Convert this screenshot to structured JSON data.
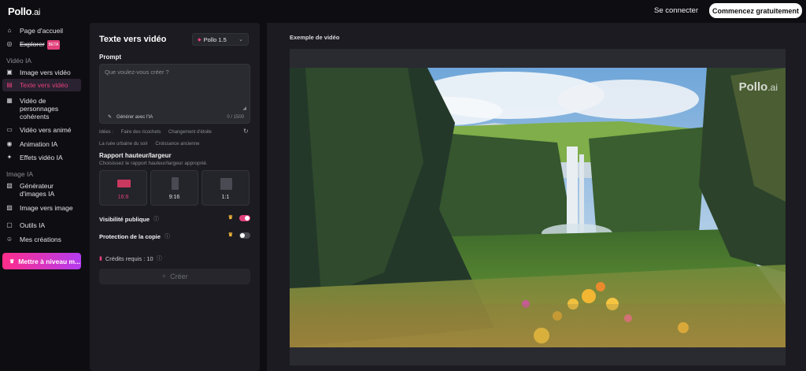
{
  "header": {
    "logo": "Pollo",
    "logo_suffix": ".ai",
    "sign_in": "Se connecter",
    "start_free": "Commencez gratuitement"
  },
  "sidebar": {
    "home": "Page d'accueil",
    "explore": "Explorer",
    "explore_badge": "BETA",
    "section_video": "Vidéo IA",
    "video_items": [
      {
        "label": "Image vers vidéo",
        "icon": "image-video-icon"
      },
      {
        "label": "Texte vers vidéo",
        "icon": "text-video-icon",
        "active": true
      },
      {
        "label": "Vidéo de personnages cohérents",
        "icon": "character-video-icon"
      },
      {
        "label": "Vidéo vers animé",
        "icon": "anime-icon"
      },
      {
        "label": "Animation IA",
        "icon": "animation-icon"
      },
      {
        "label": "Effets vidéo IA",
        "icon": "effects-icon"
      }
    ],
    "section_image": "Image IA",
    "image_items": [
      {
        "label": "Générateur d'images IA",
        "icon": "image-generator-icon"
      },
      {
        "label": "Image vers image",
        "icon": "image-to-image-icon"
      }
    ],
    "tools": "Outils IA",
    "creations": "Mes créations",
    "upgrade": "Mettre à niveau m..."
  },
  "panel": {
    "title": "Texte vers vidéo",
    "model": "Pollo 1.5",
    "prompt_label": "Prompt",
    "prompt_placeholder": "Que voulez-vous créer ?",
    "generate_ai": "Générer avec l'IA",
    "counter": "0 / 1500",
    "ideas_label": "Idées :",
    "ideas": [
      "Faire des ricochets",
      "Changement d'étoile",
      "La ruée urbaine du soir",
      "Croissance ancienne"
    ],
    "ratio_label": "Rapport hauteur/largeur",
    "ratio_hint": "Choisissez le rapport hauteur/largeur approprié.",
    "ratios": [
      {
        "label": "16:9",
        "selected": true
      },
      {
        "label": "9:16",
        "selected": false
      },
      {
        "label": "1:1",
        "selected": false
      }
    ],
    "public_visibility": "Visibilité publique",
    "public_visibility_on": true,
    "copy_protection": "Protection de la copie",
    "copy_protection_on": false,
    "credits": "Crédits requis : 10",
    "create": "Créer"
  },
  "preview": {
    "title": "Exemple de vidéo",
    "watermark": "Pollo",
    "watermark_suffix": ".ai"
  },
  "colors": {
    "accent": "#e2407a",
    "upgrade_gradient_start": "#ff2d8a",
    "upgrade_gradient_end": "#b43cf0",
    "panel_bg": "#1b1b21",
    "page_bg": "#0e0e12"
  }
}
